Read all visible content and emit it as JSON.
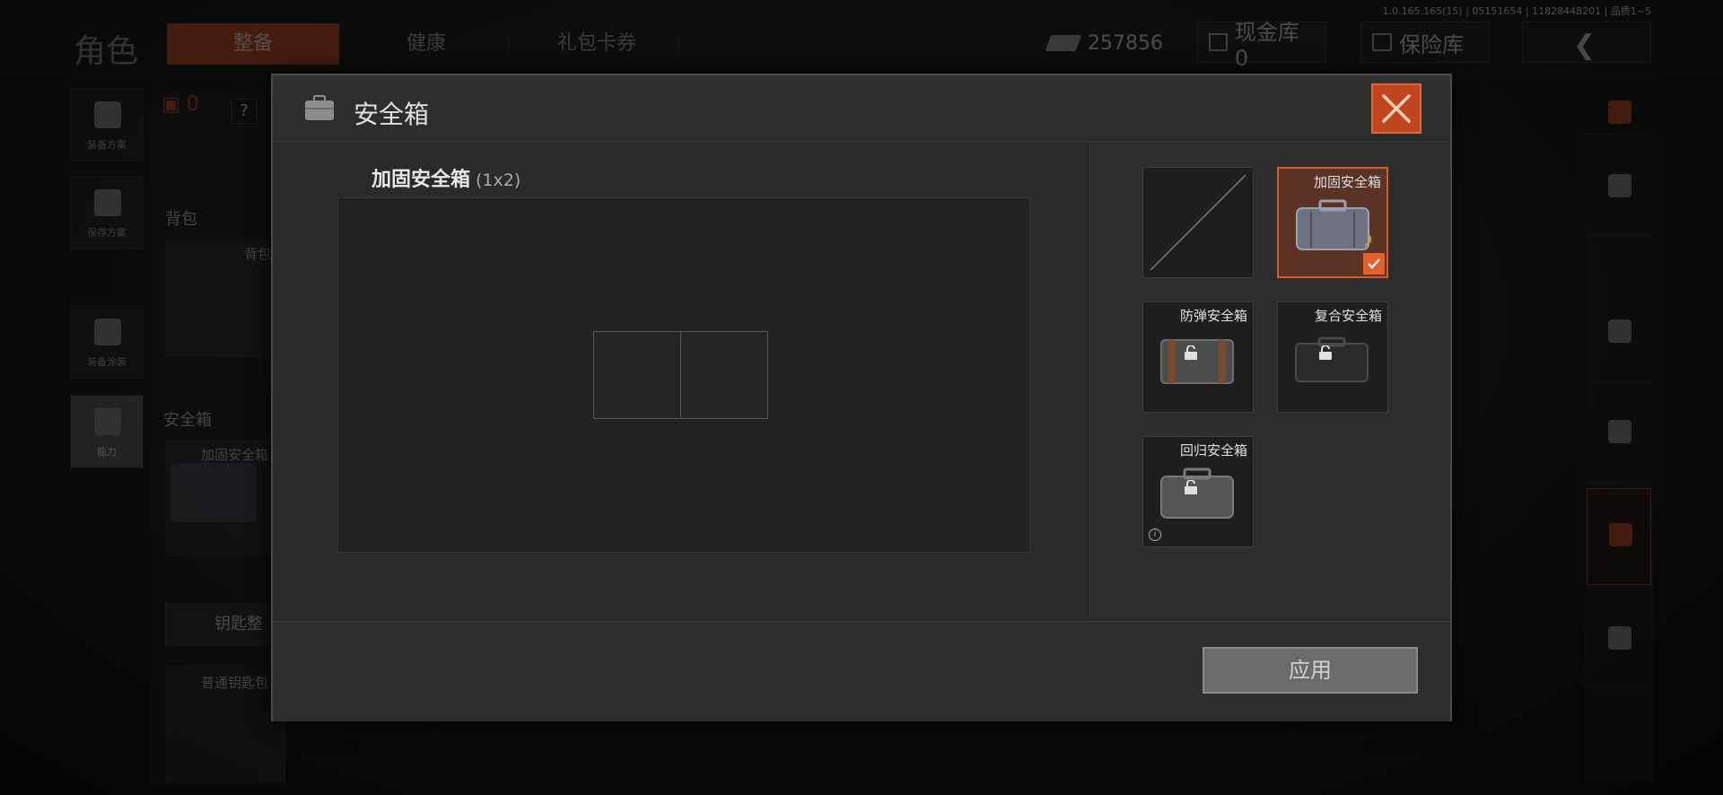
{
  "version": "1.0.165.165(15) | 05151654 | 11828448201 | 品质1~5",
  "topbar": {
    "title": "角色",
    "tabs": [
      {
        "label": "整备",
        "active": true
      },
      {
        "label": "健康",
        "active": false
      },
      {
        "label": "礼包卡券",
        "active": false
      }
    ],
    "money": "257856",
    "cash_library": "现金库 0",
    "safe_library": "保险库"
  },
  "left_sidebar": [
    {
      "label": "装备方案",
      "icon": "vest-icon"
    },
    {
      "label": "保存方案",
      "icon": "download-icon"
    },
    {
      "label": "装备涂装",
      "icon": "helmet-icon"
    },
    {
      "label": "能力",
      "icon": "energy-icon",
      "active": true
    }
  ],
  "left_panel": {
    "count": "0",
    "help": "?",
    "backpack_label": "背包",
    "backpack_slot": "背包",
    "safebox_label": "安全箱",
    "safebox_item": "加固安全箱",
    "key_button": "钥匙整",
    "key_item": "普通钥匙包"
  },
  "dialog": {
    "title": "安全箱",
    "case_name": "加固安全箱",
    "case_size": "(1x2)",
    "apply": "应用",
    "cards": [
      {
        "name": "",
        "state": "empty"
      },
      {
        "name": "加固安全箱",
        "state": "selected",
        "color": "#5a5e6b"
      },
      {
        "name": "防弹安全箱",
        "state": "locked",
        "color": "#4a4a4a"
      },
      {
        "name": "复合安全箱",
        "state": "locked",
        "color": "#2c2c2c"
      },
      {
        "name": "回归安全箱",
        "state": "locked",
        "color": "#505050"
      }
    ]
  },
  "colors": {
    "accent": "#c0461d",
    "dialog_bg": "#262626"
  }
}
